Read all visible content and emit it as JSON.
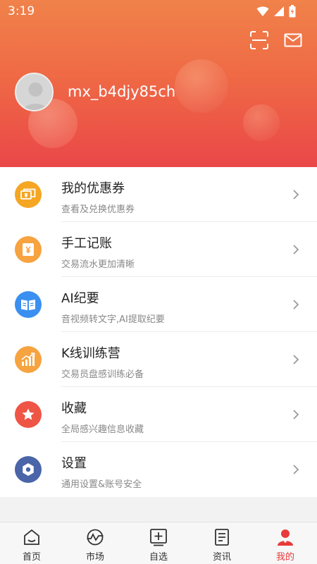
{
  "status_bar": {
    "time": "3:19"
  },
  "header": {
    "username": "mx_b4djy85ch"
  },
  "menu": [
    {
      "title": "我的优惠券",
      "subtitle": "查看及兑换优惠券",
      "icon": "coupon-icon",
      "color": "#f5a623"
    },
    {
      "title": "手工记账",
      "subtitle": "交易流水更加清晰",
      "icon": "ledger-icon",
      "color": "#f6a340"
    },
    {
      "title": "AI纪要",
      "subtitle": "音视频转文字,AI提取纪要",
      "icon": "book-icon",
      "color": "#3a8ff0"
    },
    {
      "title": "K线训练营",
      "subtitle": "交易员盘感训练必备",
      "icon": "chart-up-icon",
      "color": "#f6a340"
    },
    {
      "title": "收藏",
      "subtitle": "全局感兴趣信息收藏",
      "icon": "star-icon",
      "color": "#ef5545"
    },
    {
      "title": "设置",
      "subtitle": "通用设置&账号安全",
      "icon": "gear-icon",
      "color": "#4a65a8"
    }
  ],
  "tabs": [
    {
      "label": "首页",
      "icon": "home-icon"
    },
    {
      "label": "市场",
      "icon": "market-icon"
    },
    {
      "label": "自选",
      "icon": "watchlist-add-icon"
    },
    {
      "label": "资讯",
      "icon": "news-icon"
    },
    {
      "label": "我的",
      "icon": "profile-icon",
      "active": true
    }
  ],
  "colors": {
    "accent": "#e83a3a",
    "header_top": "#f0824a",
    "header_bottom": "#ea4748"
  }
}
